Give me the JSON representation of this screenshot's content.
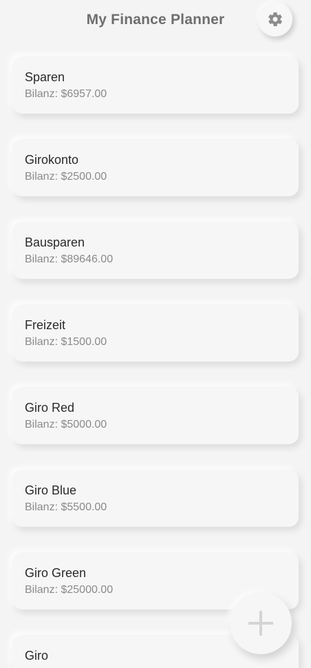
{
  "header": {
    "title": "My Finance Planner",
    "settings_icon": "gear-icon"
  },
  "accounts": [
    {
      "name": "Sparen",
      "balance": "Bilanz: $6957.00"
    },
    {
      "name": "Girokonto",
      "balance": "Bilanz: $2500.00"
    },
    {
      "name": "Bausparen",
      "balance": "Bilanz: $89646.00"
    },
    {
      "name": "Freizeit",
      "balance": "Bilanz: $1500.00"
    },
    {
      "name": "Giro Red",
      "balance": "Bilanz: $5000.00"
    },
    {
      "name": "Giro Blue",
      "balance": "Bilanz: $5500.00"
    },
    {
      "name": "Giro Green",
      "balance": "Bilanz: $25000.00"
    },
    {
      "name": "Giro",
      "balance": ""
    }
  ],
  "fab": {
    "icon": "plus-icon"
  },
  "colors": {
    "background": "#f4f4f4",
    "card": "#f6f6f6",
    "title": "#6e6e6e",
    "icon": "#8c8c8c"
  }
}
